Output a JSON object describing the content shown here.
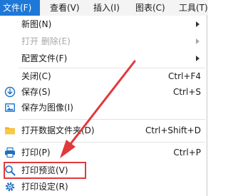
{
  "menubar": {
    "items": [
      {
        "label": "文件(F)"
      },
      {
        "label": "查看(V)"
      },
      {
        "label": "插入(I)"
      },
      {
        "label": "图表(C)"
      },
      {
        "label": "工具(T)"
      }
    ]
  },
  "file_menu": {
    "items": [
      {
        "label": "新图(N)"
      },
      {
        "label": "打开 删除(E)"
      },
      {
        "label": "配置文件(F)"
      },
      {
        "label": "关闭(C)",
        "shortcut": "Ctrl+F4"
      },
      {
        "label": "保存(S)",
        "shortcut": "Ctrl+S",
        "icon": "save-icon"
      },
      {
        "label": "保存为图像(I)",
        "icon": "image-icon"
      },
      {
        "label": "打开数据文件夹(D)",
        "shortcut": "Ctrl+Shift+D",
        "icon": "folder-icon"
      },
      {
        "label": "打印(P)",
        "shortcut": "Ctrl+P",
        "icon": "printer-icon"
      },
      {
        "label": "打印预览(V)",
        "icon": "print-preview-icon"
      },
      {
        "label": "打印设定(R)",
        "icon": "print-settings-icon"
      }
    ]
  },
  "colors": {
    "menubar_active": "#1e78d7",
    "annotation_red": "#e0393c"
  }
}
